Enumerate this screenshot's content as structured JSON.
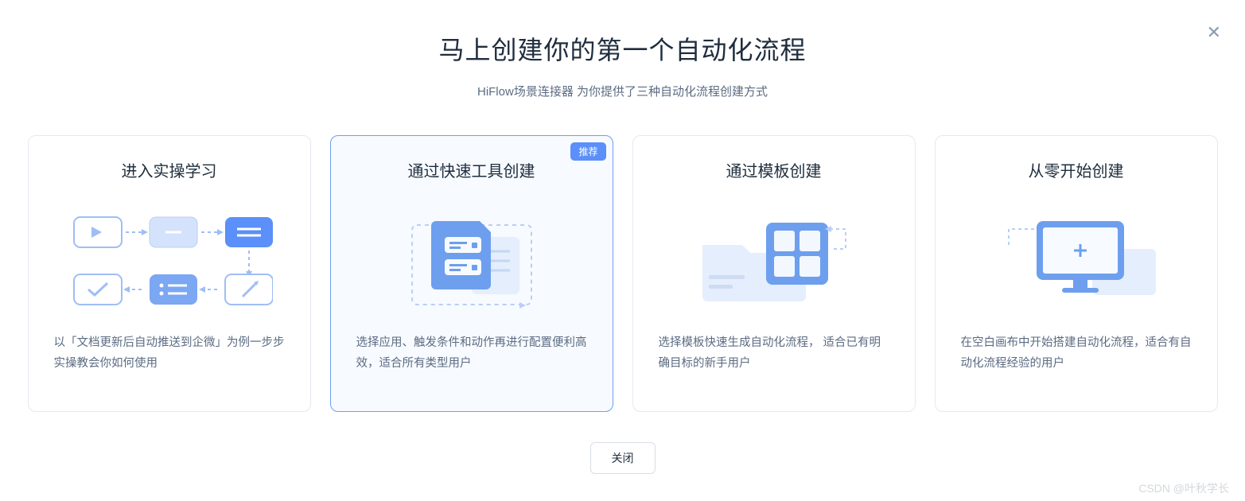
{
  "header": {
    "title": "马上创建你的第一个自动化流程",
    "subtitle": "HiFlow场景连接器 为你提供了三种自动化流程创建方式"
  },
  "cards": [
    {
      "title": "进入实操学习",
      "desc": "以「文档更新后自动推送到企微」为例一步步实操教会你如何使用",
      "badge": null
    },
    {
      "title": "通过快速工具创建",
      "desc": "选择应用、触发条件和动作再进行配置便利高效，适合所有类型用户",
      "badge": "推荐"
    },
    {
      "title": "通过模板创建",
      "desc": "选择模板快速生成自动化流程， 适合已有明确目标的新手用户",
      "badge": null
    },
    {
      "title": "从零开始创建",
      "desc": "在空白画布中开始搭建自动化流程，适合有自动化流程经验的用户",
      "badge": null
    }
  ],
  "footer": {
    "close_label": "关闭"
  },
  "watermark": "CSDN @叶秋学长"
}
